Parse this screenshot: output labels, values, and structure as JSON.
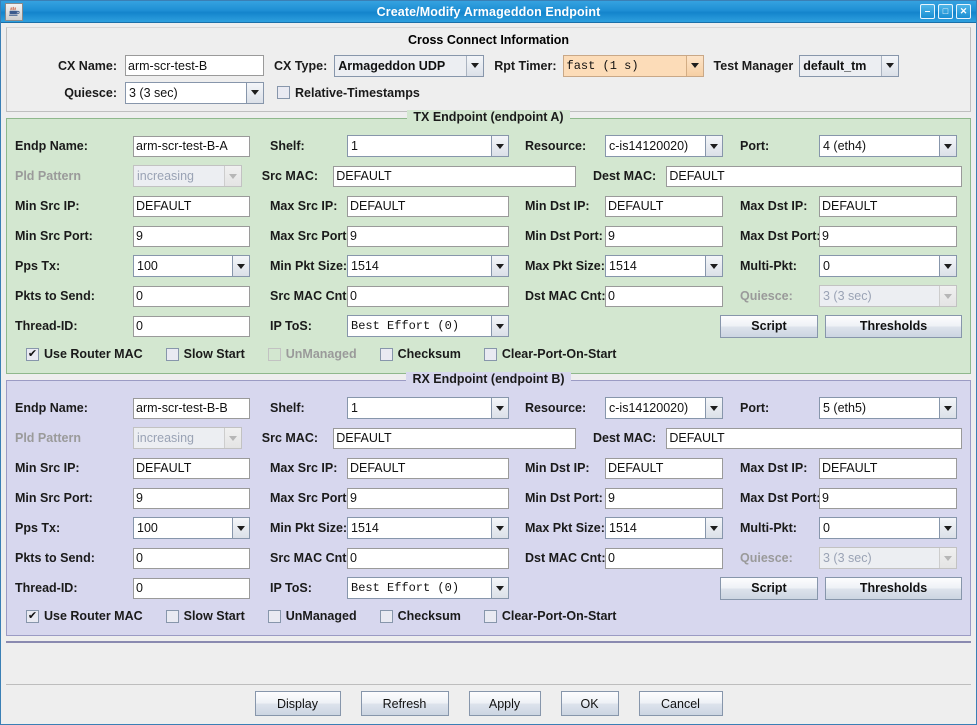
{
  "window": {
    "title": "Create/Modify Armageddon Endpoint",
    "app_icon": "java-coffee-cup-icon",
    "minimize_label": "‒",
    "maximize_label": "□",
    "close_label": "✕"
  },
  "cross_connect": {
    "section_title": "Cross Connect Information",
    "cx_name_label": "CX Name:",
    "cx_name_value": "arm-scr-test-B",
    "cx_type_label": "CX Type:",
    "cx_type_value": "Armageddon UDP",
    "rpt_timer_label": "Rpt Timer:",
    "rpt_timer_value": "fast      (1 s)",
    "test_manager_label": "Test Manager",
    "test_manager_value": "default_tm",
    "quiesce_label": "Quiesce:",
    "quiesce_value": "3 (3 sec)",
    "relative_timestamps_label": "Relative-Timestamps",
    "relative_timestamps_checked": false
  },
  "tx_endpoint": {
    "title": "TX Endpoint (endpoint A)",
    "endp_name_label": "Endp Name:",
    "endp_name_value": "arm-scr-test-B-A",
    "shelf_label": "Shelf:",
    "shelf_value": "1",
    "resource_label": "Resource:",
    "resource_value": "c-is14120020)",
    "port_label": "Port:",
    "port_value": "4 (eth4)",
    "pld_pattern_label": "Pld Pattern",
    "pld_pattern_value": "increasing",
    "src_mac_label": "Src MAC:",
    "src_mac_value": "DEFAULT",
    "dest_mac_label": "Dest MAC:",
    "dest_mac_value": "DEFAULT",
    "min_src_ip_label": "Min Src IP:",
    "min_src_ip_value": "DEFAULT",
    "max_src_ip_label": "Max Src IP:",
    "max_src_ip_value": "DEFAULT",
    "min_dst_ip_label": "Min Dst IP:",
    "min_dst_ip_value": "DEFAULT",
    "max_dst_ip_label": "Max Dst IP:",
    "max_dst_ip_value": "DEFAULT",
    "min_src_port_label": "Min Src Port:",
    "min_src_port_value": "9",
    "max_src_port_label": "Max Src Port:",
    "max_src_port_value": "9",
    "min_dst_port_label": "Min Dst Port:",
    "min_dst_port_value": "9",
    "max_dst_port_label": "Max Dst Port:",
    "max_dst_port_value": "9",
    "pps_tx_label": "Pps Tx:",
    "pps_tx_value": "100",
    "min_pkt_size_label": "Min Pkt Size:",
    "min_pkt_size_value": "1514",
    "max_pkt_size_label": "Max Pkt Size:",
    "max_pkt_size_value": "1514",
    "multi_pkt_label": "Multi-Pkt:",
    "multi_pkt_value": "0",
    "pkts_to_send_label": "Pkts to Send:",
    "pkts_to_send_value": "0",
    "src_mac_cnt_label": "Src MAC Cnt:",
    "src_mac_cnt_value": "0",
    "dst_mac_cnt_label": "Dst MAC Cnt:",
    "dst_mac_cnt_value": "0",
    "quiesce_label": "Quiesce:",
    "quiesce_value": "3 (3 sec)",
    "thread_id_label": "Thread-ID:",
    "thread_id_value": "0",
    "ip_tos_label": "IP ToS:",
    "ip_tos_value": "Best Effort    (0)",
    "script_label": "Script",
    "thresholds_label": "Thresholds",
    "use_router_mac_label": "Use Router MAC",
    "use_router_mac_checked": true,
    "slow_start_label": "Slow Start",
    "slow_start_checked": false,
    "unmanaged_label": "UnManaged",
    "unmanaged_checked": false,
    "unmanaged_disabled": true,
    "checksum_label": "Checksum",
    "checksum_checked": false,
    "clear_port_on_start_label": "Clear-Port-On-Start",
    "clear_port_on_start_checked": false
  },
  "rx_endpoint": {
    "title": "RX Endpoint (endpoint B)",
    "endp_name_label": "Endp Name:",
    "endp_name_value": "arm-scr-test-B-B",
    "shelf_label": "Shelf:",
    "shelf_value": "1",
    "resource_label": "Resource:",
    "resource_value": "c-is14120020)",
    "port_label": "Port:",
    "port_value": "5 (eth5)",
    "pld_pattern_label": "Pld Pattern",
    "pld_pattern_value": "increasing",
    "src_mac_label": "Src MAC:",
    "src_mac_value": "DEFAULT",
    "dest_mac_label": "Dest MAC:",
    "dest_mac_value": "DEFAULT",
    "min_src_ip_label": "Min Src IP:",
    "min_src_ip_value": "DEFAULT",
    "max_src_ip_label": "Max Src IP:",
    "max_src_ip_value": "DEFAULT",
    "min_dst_ip_label": "Min Dst IP:",
    "min_dst_ip_value": "DEFAULT",
    "max_dst_ip_label": "Max Dst IP:",
    "max_dst_ip_value": "DEFAULT",
    "min_src_port_label": "Min Src Port:",
    "min_src_port_value": "9",
    "max_src_port_label": "Max Src Port:",
    "max_src_port_value": "9",
    "min_dst_port_label": "Min Dst Port:",
    "min_dst_port_value": "9",
    "max_dst_port_label": "Max Dst Port:",
    "max_dst_port_value": "9",
    "pps_tx_label": "Pps Tx:",
    "pps_tx_value": "100",
    "min_pkt_size_label": "Min Pkt Size:",
    "min_pkt_size_value": "1514",
    "max_pkt_size_label": "Max Pkt Size:",
    "max_pkt_size_value": "1514",
    "multi_pkt_label": "Multi-Pkt:",
    "multi_pkt_value": "0",
    "pkts_to_send_label": "Pkts to Send:",
    "pkts_to_send_value": "0",
    "src_mac_cnt_label": "Src MAC Cnt:",
    "src_mac_cnt_value": "0",
    "dst_mac_cnt_label": "Dst MAC Cnt:",
    "dst_mac_cnt_value": "0",
    "quiesce_label": "Quiesce:",
    "quiesce_value": "3 (3 sec)",
    "thread_id_label": "Thread-ID:",
    "thread_id_value": "0",
    "ip_tos_label": "IP ToS:",
    "ip_tos_value": "Best Effort    (0)",
    "script_label": "Script",
    "thresholds_label": "Thresholds",
    "use_router_mac_label": "Use Router MAC",
    "use_router_mac_checked": true,
    "slow_start_label": "Slow Start",
    "slow_start_checked": false,
    "unmanaged_label": "UnManaged",
    "unmanaged_checked": false,
    "unmanaged_disabled": false,
    "checksum_label": "Checksum",
    "checksum_checked": false,
    "clear_port_on_start_label": "Clear-Port-On-Start",
    "clear_port_on_start_checked": false
  },
  "footer": {
    "display_label": "Display",
    "refresh_label": "Refresh",
    "apply_label": "Apply",
    "ok_label": "OK",
    "cancel_label": "Cancel"
  },
  "colors": {
    "titlebar": "#1e8fd4",
    "tx_background": "#d3e7d0",
    "rx_background": "#d7d7ee",
    "highlight_peach": "#fcdcb8",
    "panel": "#eeeeee"
  },
  "check_glyph": "✔"
}
